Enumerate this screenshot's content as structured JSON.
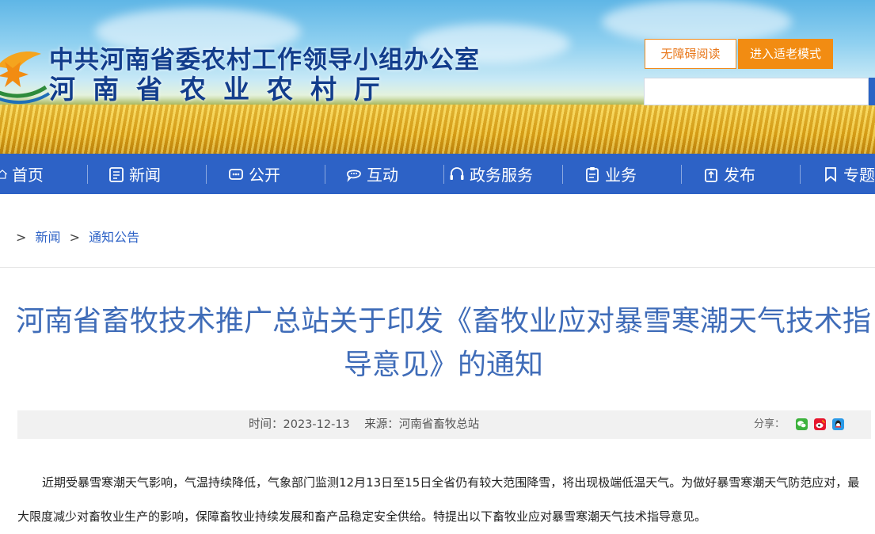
{
  "header": {
    "title_line1": "中共河南省委农村工作领导小组办公室",
    "title_line2": "河南省农业农村厅",
    "accessibility_label": "无障碍阅读",
    "elder_mode_label": "进入适老模式",
    "search_value": ""
  },
  "nav": {
    "items": [
      {
        "label": "首页",
        "icon": "home-icon"
      },
      {
        "label": "新闻",
        "icon": "news-icon"
      },
      {
        "label": "公开",
        "icon": "disclosure-icon"
      },
      {
        "label": "互动",
        "icon": "chat-icon"
      },
      {
        "label": "政务服务",
        "icon": "service-icon"
      },
      {
        "label": "业务",
        "icon": "clipboard-icon"
      },
      {
        "label": "发布",
        "icon": "publish-icon"
      },
      {
        "label": "专题",
        "icon": "bookmark-icon"
      }
    ]
  },
  "breadcrumb": {
    "sep1": ">",
    "item1": "新闻",
    "sep2": ">",
    "item2": "通知公告"
  },
  "article": {
    "title": "河南省畜牧技术推广总站关于印发《畜牧业应对暴雪寒潮天气技术指导意见》的通知",
    "time_label": "时间：",
    "time_value": "2023-12-13",
    "source_label": "来源：",
    "source_value": "河南省畜牧总站",
    "share_label": "分享：",
    "share_icons": [
      "wechat-icon",
      "weibo-icon",
      "qq-icon"
    ],
    "body": "近期受暴雪寒潮天气影响，气温持续降低，气象部门监测12月13日至15日全省仍有较大范围降雪，将出现极端低温天气。为做好暴雪寒潮天气防范应对，最大限度减少对畜牧业生产的影响，保障畜牧业持续发展和畜产品稳定安全供给。特提出以下畜牧业应对暴雪寒潮天气技术指导意见。"
  },
  "colors": {
    "nav_bg": "#2d62c6",
    "title_color": "#3f6cb8",
    "header_title": "#123d8c",
    "accent_orange": "#f28c12"
  }
}
